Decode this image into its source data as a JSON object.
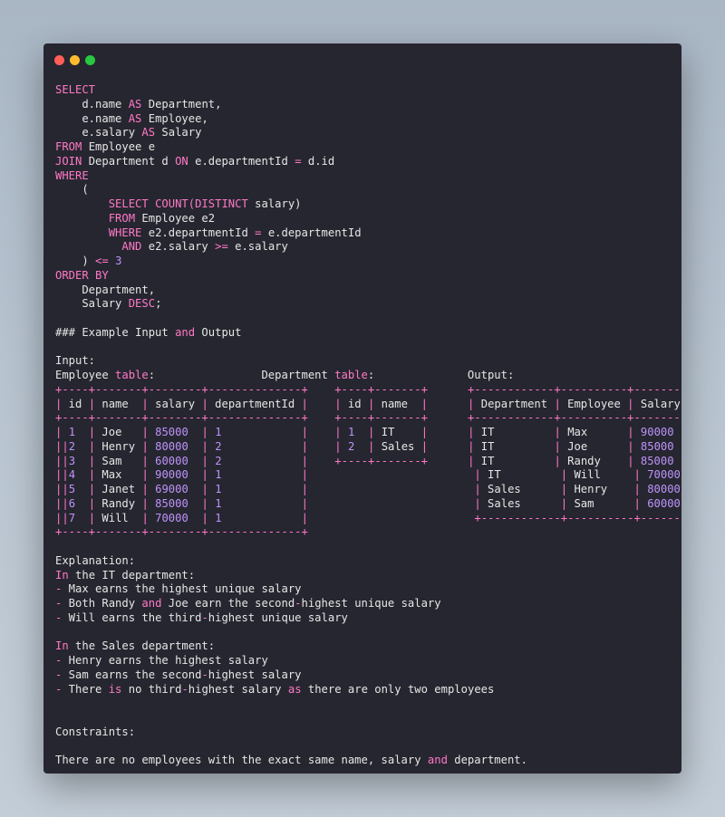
{
  "window": {
    "lights": [
      {
        "name": "close",
        "color": "#ff5f57"
      },
      {
        "name": "minimize",
        "color": "#febc2e"
      },
      {
        "name": "maximize",
        "color": "#28c840"
      }
    ]
  },
  "colors": {
    "background": "#262630",
    "text": "#e6e6e6",
    "keyword": "#ff79c6",
    "number": "#bd93f9",
    "punct": "#ff79c6"
  },
  "lines": [
    [
      [
        "kw",
        "SELECT"
      ]
    ],
    [
      [
        "t",
        "    d.name "
      ],
      [
        "kw",
        "AS"
      ],
      [
        "t",
        " Department,"
      ]
    ],
    [
      [
        "t",
        "    e.name "
      ],
      [
        "kw",
        "AS"
      ],
      [
        "t",
        " Employee,"
      ]
    ],
    [
      [
        "t",
        "    e.salary "
      ],
      [
        "kw",
        "AS"
      ],
      [
        "t",
        " Salary"
      ]
    ],
    [
      [
        "kw",
        "FROM"
      ],
      [
        "t",
        " Employee e"
      ]
    ],
    [
      [
        "kw",
        "JOIN"
      ],
      [
        "t",
        " Department d "
      ],
      [
        "kw",
        "ON"
      ],
      [
        "t",
        " e.departmentId "
      ],
      [
        "kw",
        "="
      ],
      [
        "t",
        " d.id"
      ]
    ],
    [
      [
        "kw",
        "WHERE"
      ]
    ],
    [
      [
        "t",
        "    ("
      ]
    ],
    [
      [
        "t",
        "        "
      ],
      [
        "kw",
        "SELECT COUNT(DISTINCT"
      ],
      [
        "t",
        " salary)"
      ]
    ],
    [
      [
        "t",
        "        "
      ],
      [
        "kw",
        "FROM"
      ],
      [
        "t",
        " Employee e2"
      ]
    ],
    [
      [
        "t",
        "        "
      ],
      [
        "kw",
        "WHERE"
      ],
      [
        "t",
        " e2.departmentId "
      ],
      [
        "kw",
        "="
      ],
      [
        "t",
        " e.departmentId"
      ]
    ],
    [
      [
        "t",
        "          "
      ],
      [
        "kw",
        "AND"
      ],
      [
        "t",
        " e2.salary "
      ],
      [
        "kw",
        ">="
      ],
      [
        "t",
        " e.salary"
      ]
    ],
    [
      [
        "t",
        "    ) "
      ],
      [
        "kw",
        "<="
      ],
      [
        "t",
        " "
      ],
      [
        "num",
        "3"
      ]
    ],
    [
      [
        "kw",
        "ORDER BY"
      ]
    ],
    [
      [
        "t",
        "    Department,"
      ]
    ],
    [
      [
        "t",
        "    Salary "
      ],
      [
        "kw",
        "DESC"
      ],
      [
        "t",
        ";"
      ]
    ],
    [],
    [
      [
        "t",
        "### Example Input "
      ],
      [
        "kw",
        "and"
      ],
      [
        "t",
        " Output"
      ]
    ],
    [],
    [
      [
        "t",
        "Input:"
      ]
    ],
    [
      [
        "t",
        "Employee "
      ],
      [
        "kw",
        "table"
      ],
      [
        "t",
        ":                Department "
      ],
      [
        "kw",
        "table"
      ],
      [
        "t",
        ":              Output:"
      ]
    ],
    [
      [
        "pu",
        "+----+-------+--------+--------------+"
      ],
      [
        "t",
        "    "
      ],
      [
        "pu",
        "+----+-------+"
      ],
      [
        "t",
        "      "
      ],
      [
        "pu",
        "+------------+----------+--------+"
      ]
    ],
    [
      [
        "pu",
        "|"
      ],
      [
        "t",
        " id "
      ],
      [
        "pu",
        "|"
      ],
      [
        "t",
        " name  "
      ],
      [
        "pu",
        "|"
      ],
      [
        "t",
        " salary "
      ],
      [
        "pu",
        "|"
      ],
      [
        "t",
        " departmentId "
      ],
      [
        "pu",
        "|"
      ],
      [
        "t",
        "    "
      ],
      [
        "pu",
        "|"
      ],
      [
        "t",
        " id "
      ],
      [
        "pu",
        "|"
      ],
      [
        "t",
        " name  "
      ],
      [
        "pu",
        "|"
      ],
      [
        "t",
        "      "
      ],
      [
        "pu",
        "|"
      ],
      [
        "t",
        " Department "
      ],
      [
        "pu",
        "|"
      ],
      [
        "t",
        " Employee "
      ],
      [
        "pu",
        "|"
      ],
      [
        "t",
        " Salary "
      ],
      [
        "pu",
        "|"
      ]
    ],
    [
      [
        "pu",
        "+----+-------+--------+--------------+"
      ],
      [
        "t",
        "    "
      ],
      [
        "pu",
        "+----+-------+"
      ],
      [
        "t",
        "      "
      ],
      [
        "pu",
        "+------------+----------+--------+"
      ]
    ],
    [
      [
        "pu",
        "|"
      ],
      [
        "t",
        " "
      ],
      [
        "num",
        "1"
      ],
      [
        "t",
        "  "
      ],
      [
        "pu",
        "|"
      ],
      [
        "t",
        " Joe   "
      ],
      [
        "pu",
        "|"
      ],
      [
        "t",
        " "
      ],
      [
        "num",
        "85000"
      ],
      [
        "t",
        "  "
      ],
      [
        "pu",
        "|"
      ],
      [
        "t",
        " "
      ],
      [
        "num",
        "1"
      ],
      [
        "t",
        "            "
      ],
      [
        "pu",
        "|"
      ],
      [
        "t",
        "    "
      ],
      [
        "pu",
        "|"
      ],
      [
        "t",
        " "
      ],
      [
        "num",
        "1"
      ],
      [
        "t",
        "  "
      ],
      [
        "pu",
        "|"
      ],
      [
        "t",
        " IT    "
      ],
      [
        "pu",
        "|"
      ],
      [
        "t",
        "      "
      ],
      [
        "pu",
        "|"
      ],
      [
        "t",
        " IT         "
      ],
      [
        "pu",
        "|"
      ],
      [
        "t",
        " Max      "
      ],
      [
        "pu",
        "|"
      ],
      [
        "t",
        " "
      ],
      [
        "num",
        "90000"
      ],
      [
        "t",
        "  "
      ]
    ],
    [
      [
        "pu",
        "||"
      ],
      [
        "num",
        "2"
      ],
      [
        "t",
        "  "
      ],
      [
        "pu",
        "|"
      ],
      [
        "t",
        " Henry "
      ],
      [
        "pu",
        "|"
      ],
      [
        "t",
        " "
      ],
      [
        "num",
        "80000"
      ],
      [
        "t",
        "  "
      ],
      [
        "pu",
        "|"
      ],
      [
        "t",
        " "
      ],
      [
        "num",
        "2"
      ],
      [
        "t",
        "            "
      ],
      [
        "pu",
        "|"
      ],
      [
        "t",
        "    "
      ],
      [
        "pu",
        "|"
      ],
      [
        "t",
        " "
      ],
      [
        "num",
        "2"
      ],
      [
        "t",
        "  "
      ],
      [
        "pu",
        "|"
      ],
      [
        "t",
        " Sales "
      ],
      [
        "pu",
        "|"
      ],
      [
        "t",
        "      "
      ],
      [
        "pu",
        "|"
      ],
      [
        "t",
        " IT         "
      ],
      [
        "pu",
        "|"
      ],
      [
        "t",
        " Joe      "
      ],
      [
        "pu",
        "|"
      ],
      [
        "t",
        " "
      ],
      [
        "num",
        "85000"
      ],
      [
        "t",
        "  "
      ]
    ],
    [
      [
        "pu",
        "||"
      ],
      [
        "num",
        "3"
      ],
      [
        "t",
        "  "
      ],
      [
        "pu",
        "|"
      ],
      [
        "t",
        " Sam   "
      ],
      [
        "pu",
        "|"
      ],
      [
        "t",
        " "
      ],
      [
        "num",
        "60000"
      ],
      [
        "t",
        "  "
      ],
      [
        "pu",
        "|"
      ],
      [
        "t",
        " "
      ],
      [
        "num",
        "2"
      ],
      [
        "t",
        "            "
      ],
      [
        "pu",
        "|"
      ],
      [
        "t",
        "    "
      ],
      [
        "pu",
        "+----+-------+"
      ],
      [
        "t",
        "      "
      ],
      [
        "pu",
        "|"
      ],
      [
        "t",
        " IT         "
      ],
      [
        "pu",
        "|"
      ],
      [
        "t",
        " Randy    "
      ],
      [
        "pu",
        "|"
      ],
      [
        "t",
        " "
      ],
      [
        "num",
        "85000"
      ],
      [
        "t",
        "  "
      ]
    ],
    [
      [
        "pu",
        "||"
      ],
      [
        "num",
        "4"
      ],
      [
        "t",
        "  "
      ],
      [
        "pu",
        "|"
      ],
      [
        "t",
        " Max   "
      ],
      [
        "pu",
        "|"
      ],
      [
        "t",
        " "
      ],
      [
        "num",
        "90000"
      ],
      [
        "t",
        "  "
      ],
      [
        "pu",
        "|"
      ],
      [
        "t",
        " "
      ],
      [
        "num",
        "1"
      ],
      [
        "t",
        "            "
      ],
      [
        "pu",
        "|"
      ],
      [
        "t",
        "                         "
      ],
      [
        "pu",
        "|"
      ],
      [
        "t",
        " IT         "
      ],
      [
        "pu",
        "|"
      ],
      [
        "t",
        " Will     "
      ],
      [
        "pu",
        "|"
      ],
      [
        "t",
        " "
      ],
      [
        "num",
        "70000"
      ],
      [
        "t",
        "  "
      ]
    ],
    [
      [
        "pu",
        "||"
      ],
      [
        "num",
        "5"
      ],
      [
        "t",
        "  "
      ],
      [
        "pu",
        "|"
      ],
      [
        "t",
        " Janet "
      ],
      [
        "pu",
        "|"
      ],
      [
        "t",
        " "
      ],
      [
        "num",
        "69000"
      ],
      [
        "t",
        "  "
      ],
      [
        "pu",
        "|"
      ],
      [
        "t",
        " "
      ],
      [
        "num",
        "1"
      ],
      [
        "t",
        "            "
      ],
      [
        "pu",
        "|"
      ],
      [
        "t",
        "                         "
      ],
      [
        "pu",
        "|"
      ],
      [
        "t",
        " Sales      "
      ],
      [
        "pu",
        "|"
      ],
      [
        "t",
        " Henry    "
      ],
      [
        "pu",
        "|"
      ],
      [
        "t",
        " "
      ],
      [
        "num",
        "80000"
      ],
      [
        "t",
        "  "
      ]
    ],
    [
      [
        "pu",
        "||"
      ],
      [
        "num",
        "6"
      ],
      [
        "t",
        "  "
      ],
      [
        "pu",
        "|"
      ],
      [
        "t",
        " Randy "
      ],
      [
        "pu",
        "|"
      ],
      [
        "t",
        " "
      ],
      [
        "num",
        "85000"
      ],
      [
        "t",
        "  "
      ],
      [
        "pu",
        "|"
      ],
      [
        "t",
        " "
      ],
      [
        "num",
        "1"
      ],
      [
        "t",
        "            "
      ],
      [
        "pu",
        "|"
      ],
      [
        "t",
        "                         "
      ],
      [
        "pu",
        "|"
      ],
      [
        "t",
        " Sales      "
      ],
      [
        "pu",
        "|"
      ],
      [
        "t",
        " Sam      "
      ],
      [
        "pu",
        "|"
      ],
      [
        "t",
        " "
      ],
      [
        "num",
        "60000"
      ],
      [
        "t",
        "  "
      ]
    ],
    [
      [
        "pu",
        "||"
      ],
      [
        "num",
        "7"
      ],
      [
        "t",
        "  "
      ],
      [
        "pu",
        "|"
      ],
      [
        "t",
        " Will  "
      ],
      [
        "pu",
        "|"
      ],
      [
        "t",
        " "
      ],
      [
        "num",
        "70000"
      ],
      [
        "t",
        "  "
      ],
      [
        "pu",
        "|"
      ],
      [
        "t",
        " "
      ],
      [
        "num",
        "1"
      ],
      [
        "t",
        "            "
      ],
      [
        "pu",
        "|"
      ],
      [
        "t",
        "                         "
      ],
      [
        "pu",
        "+------------+----------+--------"
      ]
    ],
    [
      [
        "pu",
        "+----+-------+--------+--------------+"
      ]
    ],
    [],
    [
      [
        "t",
        "Explanation:"
      ]
    ],
    [
      [
        "kw",
        "In"
      ],
      [
        "t",
        " the IT department:"
      ]
    ],
    [
      [
        "kw",
        "-"
      ],
      [
        "t",
        " Max earns the highest unique salary"
      ]
    ],
    [
      [
        "kw",
        "-"
      ],
      [
        "t",
        " Both Randy "
      ],
      [
        "kw",
        "and"
      ],
      [
        "t",
        " Joe earn the second"
      ],
      [
        "kw",
        "-"
      ],
      [
        "t",
        "highest unique salary"
      ]
    ],
    [
      [
        "kw",
        "-"
      ],
      [
        "t",
        " Will earns the third"
      ],
      [
        "kw",
        "-"
      ],
      [
        "t",
        "highest unique salary"
      ]
    ],
    [],
    [
      [
        "kw",
        "In"
      ],
      [
        "t",
        " the Sales department:"
      ]
    ],
    [
      [
        "kw",
        "-"
      ],
      [
        "t",
        " Henry earns the highest salary"
      ]
    ],
    [
      [
        "kw",
        "-"
      ],
      [
        "t",
        " Sam earns the second"
      ],
      [
        "kw",
        "-"
      ],
      [
        "t",
        "highest salary"
      ]
    ],
    [
      [
        "kw",
        "-"
      ],
      [
        "t",
        " There "
      ],
      [
        "kw",
        "is"
      ],
      [
        "t",
        " no third"
      ],
      [
        "kw",
        "-"
      ],
      [
        "t",
        "highest salary "
      ],
      [
        "kw",
        "as"
      ],
      [
        "t",
        " there are only two employees"
      ]
    ],
    [],
    [],
    [
      [
        "t",
        "Constraints:"
      ]
    ],
    [],
    [
      [
        "t",
        "There are no employees with the exact same name, salary "
      ],
      [
        "kw",
        "and"
      ],
      [
        "t",
        " department."
      ]
    ]
  ]
}
